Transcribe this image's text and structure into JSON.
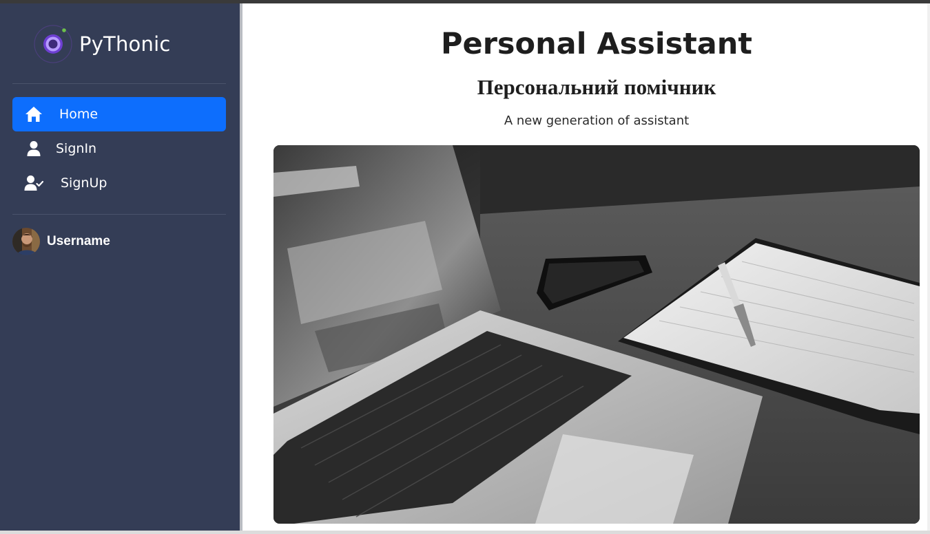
{
  "brand": {
    "name": "PyThonic",
    "logo_icon": "ring-logo-icon"
  },
  "sidebar": {
    "items": [
      {
        "label": "Home",
        "icon": "home-icon",
        "active": true
      },
      {
        "label": "SignIn",
        "icon": "user-icon",
        "active": false
      },
      {
        "label": "SignUp",
        "icon": "user-check-icon",
        "active": false
      }
    ],
    "user": {
      "name": "Username",
      "avatar": "avatar-photo"
    }
  },
  "main": {
    "title": "Personal Assistant",
    "subtitle": "Персональний помічник",
    "tagline": "A new generation of assistant",
    "hero_image": "laptop-phone-notebook-photo"
  },
  "colors": {
    "sidebar_bg": "#343d56",
    "active_bg": "#0d6efd",
    "text_dark": "#1e1e1e",
    "logo_accent": "#8b5cf6",
    "logo_dot": "#6cc04a"
  }
}
